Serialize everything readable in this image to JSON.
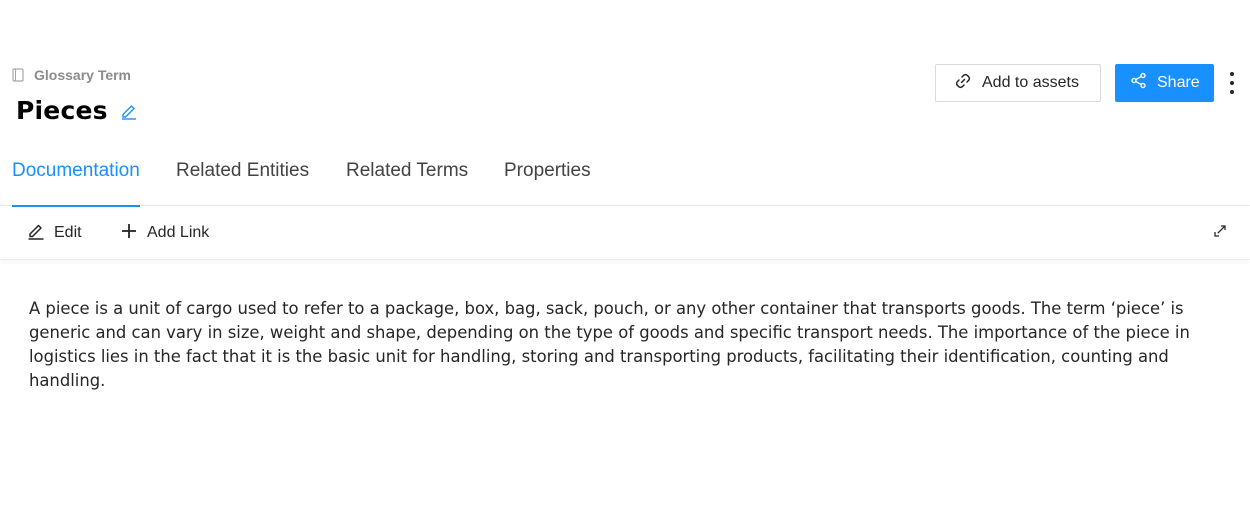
{
  "header": {
    "entity_type": "Glossary Term",
    "entity_type_icon": "book-icon",
    "title": "Pieces",
    "edit_icon": "pencil-icon"
  },
  "actions": {
    "add_to_assets": "Add to assets",
    "add_to_assets_icon": "link-icon",
    "share": "Share",
    "share_icon": "share-icon",
    "more_icon": "vertical-dots-icon"
  },
  "tabs": [
    {
      "label": "Documentation",
      "active": true
    },
    {
      "label": "Related Entities",
      "active": false
    },
    {
      "label": "Related Terms",
      "active": false
    },
    {
      "label": "Properties",
      "active": false
    }
  ],
  "toolbar": {
    "edit_label": "Edit",
    "edit_icon": "pencil-icon",
    "add_link_label": "Add Link",
    "add_link_icon": "plus-icon",
    "expand_icon": "expand-icon"
  },
  "documentation": {
    "text": "A piece is a unit of cargo used to refer to a package, box, bag, sack, pouch, or any other container that transports goods. The term ‘piece’ is generic and can vary in size, weight and shape, depending on the type of goods and specific transport needs. The importance of the piece in logistics lies in the fact that it is the basic unit for handling, storing and transporting products, facilitating their identification, counting and handling."
  },
  "colors": {
    "accent": "#1890ff",
    "text": "#262626",
    "muted": "#8c8c8c",
    "border": "#d9d9d9"
  }
}
